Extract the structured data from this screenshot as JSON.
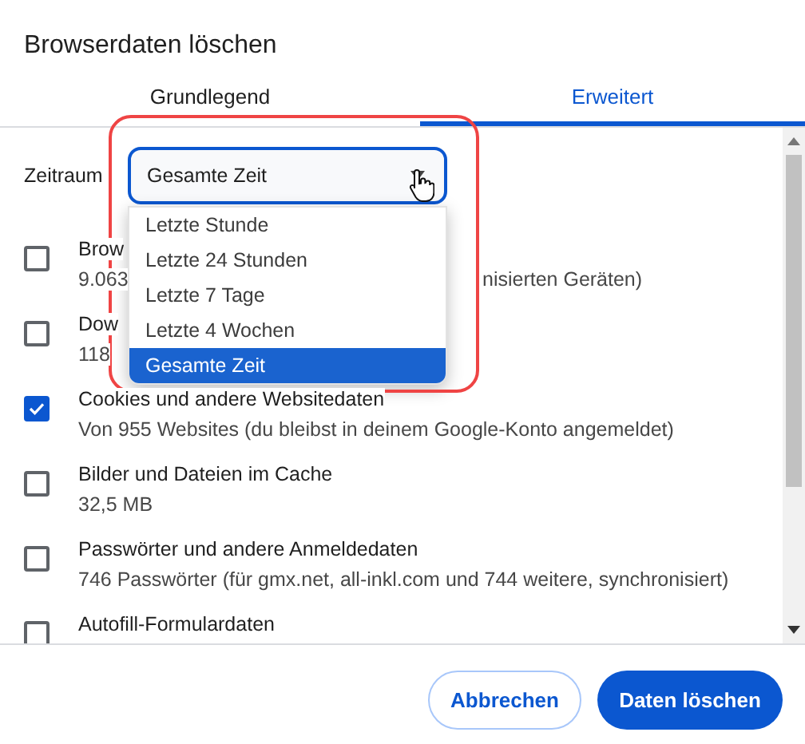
{
  "dialog": {
    "title": "Browserdaten löschen"
  },
  "tabs": [
    {
      "label": "Grundlegend",
      "selected": false
    },
    {
      "label": "Erweitert",
      "selected": true
    }
  ],
  "time_range": {
    "label": "Zeitraum",
    "value": "Gesamte Zeit",
    "expanded": true,
    "options": [
      {
        "label": "Letzte Stunde",
        "selected": false
      },
      {
        "label": "Letzte 24 Stunden",
        "selected": false
      },
      {
        "label": "Letzte 7 Tage",
        "selected": false
      },
      {
        "label": "Letzte 4 Wochen",
        "selected": false
      },
      {
        "label": "Gesamte Zeit",
        "selected": true
      }
    ]
  },
  "items": [
    {
      "checked": false,
      "title": "Brow",
      "detail": "9.063",
      "detail_end": "nisierten Geräten)"
    },
    {
      "checked": false,
      "title": "Dow",
      "detail": "118"
    },
    {
      "checked": true,
      "title": "Cookies und andere Websitedaten",
      "detail": "Von 955 Websites (du bleibst in deinem Google-Konto angemeldet)"
    },
    {
      "checked": false,
      "title": "Bilder und Dateien im Cache",
      "detail": "32,5 MB"
    },
    {
      "checked": false,
      "title": "Passwörter und andere Anmeldedaten",
      "detail": "746 Passwörter (für gmx.net, all-inkl.com und 744 weitere, synchronisiert)"
    },
    {
      "checked": false,
      "title": "Autofill-Formulardaten"
    }
  ],
  "buttons": [
    {
      "label": "Abbrechen",
      "kind": "secondary"
    },
    {
      "label": "Daten löschen",
      "kind": "primary"
    }
  ]
}
